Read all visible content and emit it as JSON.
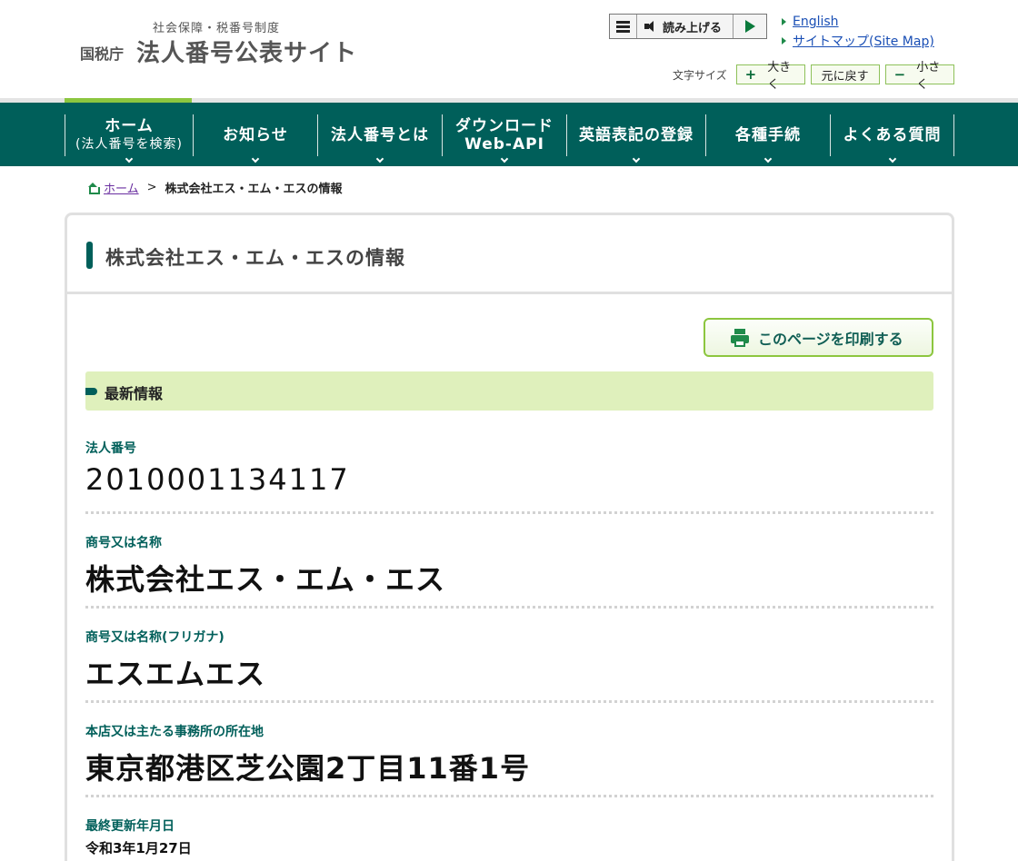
{
  "header": {
    "logo_sub": "社会保障・税番号制度",
    "logo_agency": "国税庁",
    "logo_main": "法人番号公表サイト",
    "read_aloud_label": "読み上げる",
    "links": [
      {
        "label": "English"
      },
      {
        "label": "サイトマップ(Site Map)"
      }
    ],
    "font_size_label": "文字サイズ",
    "font_buttons": [
      {
        "sign": "+",
        "label": "大きく"
      },
      {
        "sign": "",
        "label": "元に戻す"
      },
      {
        "sign": "−",
        "label": "小さく"
      }
    ]
  },
  "nav": {
    "items": [
      {
        "line1": "ホーム",
        "line2": "(法人番号を検索)"
      },
      {
        "line1": "お知らせ",
        "line2": ""
      },
      {
        "line1": "法人番号とは",
        "line2": ""
      },
      {
        "line1": "ダウンロード",
        "line2": "Web-API"
      },
      {
        "line1": "英語表記の登録",
        "line2": ""
      },
      {
        "line1": "各種手続",
        "line2": ""
      },
      {
        "line1": "よくある質問",
        "line2": ""
      }
    ]
  },
  "breadcrumb": {
    "home": "ホーム",
    "separator": ">",
    "current": "株式会社エス・エム・エスの情報"
  },
  "main": {
    "title": "株式会社エス・エム・エスの情報",
    "print_label": "このページを印刷する",
    "section_title": "最新情報",
    "fields": [
      {
        "label": "法人番号",
        "value": "2010001134117"
      },
      {
        "label": "商号又は名称",
        "value": "株式会社エス・エム・エス"
      },
      {
        "label": "商号又は名称(フリガナ)",
        "value": "エスエムエス"
      },
      {
        "label": "本店又は主たる事務所の所在地",
        "value": "東京都港区芝公園2丁目11番1号"
      },
      {
        "label": "最終更新年月日",
        "value": "令和3年1月27日"
      }
    ]
  },
  "colors": {
    "nav_bg": "#005f5a",
    "accent_green": "#8cc63f",
    "section_bg": "#dff0bc",
    "link": "#1a4fb5"
  }
}
